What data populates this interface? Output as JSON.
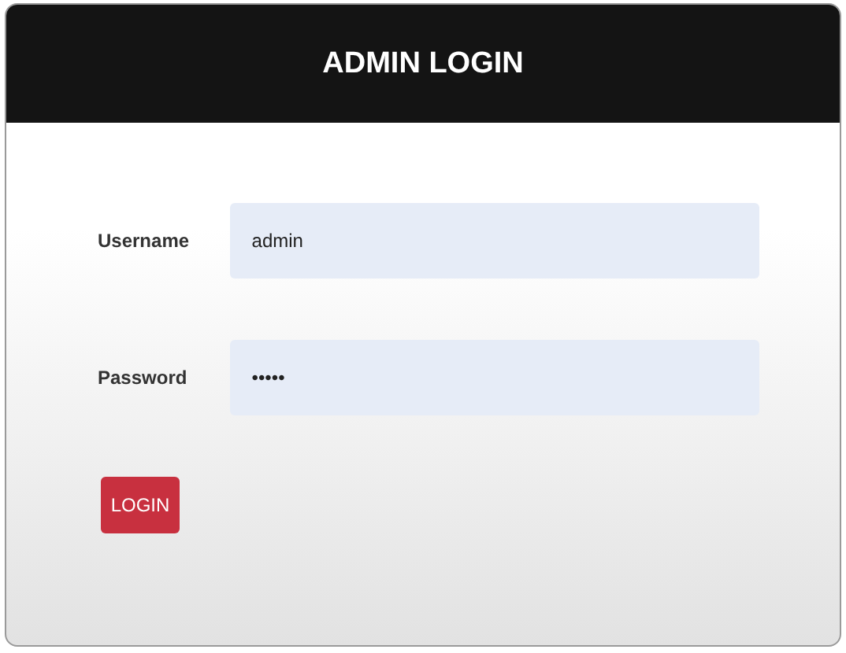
{
  "header": {
    "title": "ADMIN LOGIN"
  },
  "fields": [
    {
      "label": "Username",
      "value": "admin"
    },
    {
      "label": "Password",
      "value": "•••••"
    }
  ],
  "button": {
    "label": "LOGIN"
  }
}
